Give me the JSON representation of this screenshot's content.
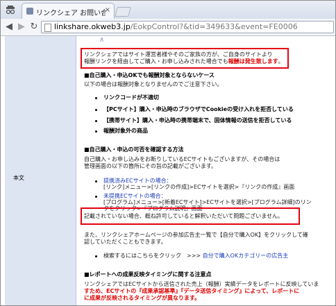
{
  "browser": {
    "tab_title": "リンクシェア お問い合わせ",
    "tab_close": "×",
    "url_host": "linkshare.okweb3.jp",
    "url_path": "/EokpControl?&tid=349633&event=FE0006",
    "back": "◀",
    "forward": "▶",
    "reload": "↻"
  },
  "left": {
    "label": "本文"
  },
  "content": {
    "caret": "∧",
    "intro1": "リンクシェアではサイト運営者様やそのご家族の方が、ご自身のサイトより",
    "intro2_a": "報酬リンクを経由してご購入・お申し込みされた場合でも",
    "intro2_b": "報酬は発生致します",
    "intro2_c": "。",
    "sec1_title": "■自己購入・申込OKでも報酬対象とならないケース",
    "sec1_sub": "以下の場合は報酬対象となりませんのでご注意下さい。",
    "sec1_items": [
      "リンクコードが不適切",
      "【PCサイト】購入・申込時のブラウザでCookieの受け入れを拒否している",
      "【携帯サイト】購入・申込時の携帯端末で、固体情報の送信を拒否している",
      "報酬対象外の商品"
    ],
    "sec2_title": "■自己購入・申込の可否を確認する方法",
    "sec2_p1": "自己購入・お申し込みをお断りしているECサイトもございますが、その場合は",
    "sec2_p2": "管理画面の以下の箇所にその旨の記載がございます。",
    "sec2_item1_a": "提携済みECサイトの場合：",
    "sec2_item1_b": "[リンク]メニュー>[リンクの作成]>ECサイトを選択>『リンクの作成』画面",
    "sec2_item2_a": "未提携ECサイトの場合：",
    "sec2_item2_b": "[プログラム]メニュー>[新着ECサイト]>ECサイトを選択>[プログラム詳細]のリン",
    "sec2_item2_c": "クをクリック>『プログラム説明』画面",
    "note": "記載されていない場合、概ね許可していると解釈いただいて問題ございません。",
    "p3_a": "また、リンクシェアホームページの参加広告主一覧で【自分で購入OK】をクリックして確",
    "p3_b": "認していただくこともできます。",
    "search_a": "検索するにはこちらをクリック　>>> ",
    "search_link": "自分で購入OKカテゴリーの広告主",
    "sec3_title": "■レポートへの成果反映タイミングに関する注意点",
    "sec3_p1": "リンクシェアではECサイトから送信された売上（報酬）実績データをレポートに反映していま",
    "sec3_p2": "すため、ECサイトの『成果承認基準』『データ送信タイミング』によって、レポートに",
    "sec3_p3": "に成果が反映されるタイミングが異なります。"
  },
  "colors": {
    "highlight_box": "#e60012",
    "red_text": "#e00000",
    "left_column": "#dde5f3"
  }
}
